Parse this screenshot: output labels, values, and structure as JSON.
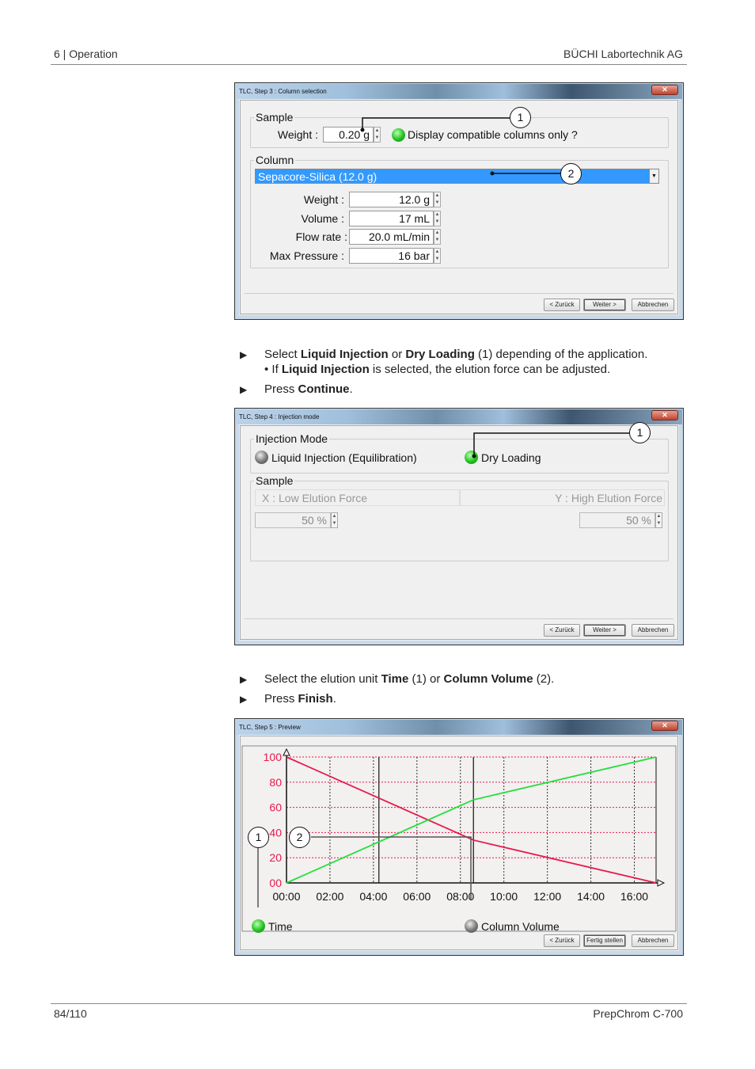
{
  "header": {
    "left": "6 | Operation",
    "right": "BÜCHI Labortechnik AG"
  },
  "footer": {
    "left": "84/110",
    "right": "PrepChrom C-700"
  },
  "dialog1": {
    "title": "TLC, Step 3 : Column selection",
    "sample_group": "Sample",
    "weight_label": "Weight :",
    "weight_value": "0.20 g",
    "compatible_label": "Display compatible columns only ?",
    "compatible_checked": true,
    "column_group": "Column",
    "column_selected": "Sepacore-Silica (12.0 g)",
    "fields": [
      {
        "label": "Weight :",
        "value": "12.0 g"
      },
      {
        "label": "Volume :",
        "value": "17 mL"
      },
      {
        "label": "Flow rate :",
        "value": "20.0 mL/min"
      },
      {
        "label": "Max Pressure :",
        "value": "16 bar"
      }
    ],
    "callouts": [
      "1",
      "2"
    ],
    "buttons": {
      "back": "< Zurück",
      "next": "Weiter >",
      "cancel": "Abbrechen"
    }
  },
  "instructions1": [
    {
      "type": "step",
      "parts": [
        {
          "t": "Select "
        },
        {
          "t": "Liquid Injection",
          "b": true
        },
        {
          "t": " or "
        },
        {
          "t": "Dry Loading",
          "b": true
        },
        {
          "t": " (1) depending of the application."
        }
      ]
    },
    {
      "type": "sub",
      "parts": [
        {
          "t": "• If "
        },
        {
          "t": "Liquid Injection",
          "b": true
        },
        {
          "t": " is selected, the elution force can be adjusted."
        }
      ]
    },
    {
      "type": "step",
      "parts": [
        {
          "t": "Press "
        },
        {
          "t": "Continue",
          "b": true
        },
        {
          "t": "."
        }
      ]
    }
  ],
  "dialog2": {
    "title": "TLC, Step 4 : Injection mode",
    "injection_group": "Injection Mode",
    "liquid_injection": "Liquid Injection (Equilibration)",
    "dry_loading": "Dry Loading",
    "selected": "Dry Loading",
    "sample_group": "Sample",
    "x_label": "X : Low Elution Force",
    "y_label": "Y : High Elution Force",
    "x_value": "50 %",
    "y_value": "50 %",
    "callouts": [
      "1"
    ],
    "buttons": {
      "back": "< Zurück",
      "next": "Weiter >",
      "cancel": "Abbrechen"
    }
  },
  "instructions2": [
    {
      "type": "step",
      "parts": [
        {
          "t": "Select the elution unit "
        },
        {
          "t": "Time",
          "b": true
        },
        {
          "t": " (1) or "
        },
        {
          "t": "Column Volume",
          "b": true
        },
        {
          "t": " (2)."
        }
      ]
    },
    {
      "type": "step",
      "parts": [
        {
          "t": "Press "
        },
        {
          "t": "Finish",
          "b": true
        },
        {
          "t": "."
        }
      ]
    }
  ],
  "dialog3": {
    "title": "TLC, Step 5 : Preview",
    "unit_time": "Time",
    "unit_cv": "Column Volume",
    "selected_unit": "Time",
    "callouts": [
      "1",
      "2"
    ],
    "buttons": {
      "back": "< Zurück",
      "finish": "Fertig stellen",
      "cancel": "Abbrechen"
    }
  },
  "chart_data": {
    "type": "line",
    "xlim": [
      0,
      17
    ],
    "ylim": [
      0,
      100
    ],
    "x_ticks": [
      "00:00",
      "02:00",
      "04:00",
      "06:00",
      "08:00",
      "10:00",
      "12:00",
      "14:00",
      "16:00"
    ],
    "y_ticks": [
      "00",
      "20",
      "40",
      "60",
      "80",
      "100"
    ],
    "grid": true,
    "colors": {
      "red": "#e8194a",
      "green": "#22e03a",
      "grid": "#e8194a"
    },
    "series": [
      {
        "color": "#e8194a",
        "points": [
          [
            0,
            100
          ],
          [
            8.6,
            34
          ],
          [
            17,
            0
          ]
        ]
      },
      {
        "color": "#22e03a",
        "points": [
          [
            0,
            0
          ],
          [
            8.6,
            66
          ],
          [
            17,
            100
          ]
        ]
      }
    ],
    "markers_x": [
      4.25,
      8.6
    ]
  }
}
